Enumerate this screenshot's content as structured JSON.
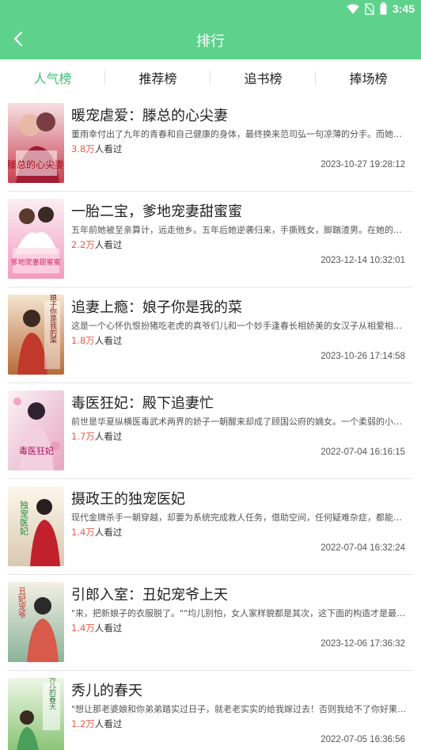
{
  "status_bar": {
    "time": "3:45",
    "icons": [
      "wifi-icon",
      "no-sim-icon",
      "battery-icon"
    ]
  },
  "header": {
    "title": "排行",
    "back_icon": "chevron-left-icon"
  },
  "colors": {
    "brand_green": "#5ed28c",
    "active_tab": "#3bbf73",
    "reader_count": "#ee5a4a"
  },
  "tabs": [
    {
      "label": "人气榜",
      "active": true
    },
    {
      "label": "推荐榜",
      "active": false
    },
    {
      "label": "追书榜",
      "active": false
    },
    {
      "label": "捧场榜",
      "active": false
    }
  ],
  "books": [
    {
      "title": "暖宠虐爱：滕总的心尖妻",
      "desc": "董雨幸付出了九年的青春和自己健康的身体，最终换来范司弘一句凉薄的分手。而她父亲也得了重病",
      "readers": "3.8万",
      "readers_suffix": "人看过",
      "time": "2023-10-27 19:28:12",
      "cover_text": "滕总的心尖妻"
    },
    {
      "title": "一胎二宝，爹地宠妻甜蜜蜜",
      "desc": "五年前她被至亲算计，远走他乡。五年后她逆袭归来，手撕贱女，脚踹渣男。在她的人生里，",
      "readers": "2.2万",
      "readers_suffix": "人看过",
      "time": "2023-12-14 10:32:01",
      "cover_text": "爹地宠妻甜蜜蜜"
    },
    {
      "title": "追妻上瘾：娘子你是我的菜",
      "desc": "这是一个心怀仇恨扮猪吃老虎的真爷们儿和一个妙手逢春长相娇美的女汉子从相爱相杀到相知相守",
      "readers": "1.8万",
      "readers_suffix": "人看过",
      "time": "2023-10-26 17:14:58",
      "cover_text": "娘子你是我的菜"
    },
    {
      "title": "毒医狂妃：殿下追妻忙",
      "desc": "前世是华夏纵横医毒武术两界的娇子一朝醒来却成了顾国公府的嫡女。一个柔弱的小姑娘，",
      "readers": "1.7万",
      "readers_suffix": "人看过",
      "time": "2022-07-04 16:16:15",
      "cover_text": "毒医狂妃"
    },
    {
      "title": "摄政王的独宠医妃",
      "desc": "现代金牌杀手一朝穿越，却要为系统完成救人任务，借助空间，任何疑难杂症，都能妙手回春",
      "readers": "1.4万",
      "readers_suffix": "人看过",
      "time": "2022-07-04 16:32:24",
      "cover_text": "独宠医妃"
    },
    {
      "title": "引郎入室：丑妃宠爷上天",
      "desc": "\"来，把新娘子的衣服脱了。\"\"均儿别怕，女人家样貌都是其次，这下面的构造才是最重要的",
      "readers": "1.4万",
      "readers_suffix": "人看过",
      "time": "2023-12-06 17:36:32",
      "cover_text": "丑妃宠爷"
    },
    {
      "title": "秀儿的春天",
      "desc": "\"想让那老婆娘和你弟弟踏实过日子，就老老实实的给我嫁过去！否则我给不了你好果子吃",
      "readers": "1.2万",
      "readers_suffix": "人看过",
      "time": "2022-07-05 16:36:56",
      "cover_text": "秀儿的春天"
    }
  ]
}
